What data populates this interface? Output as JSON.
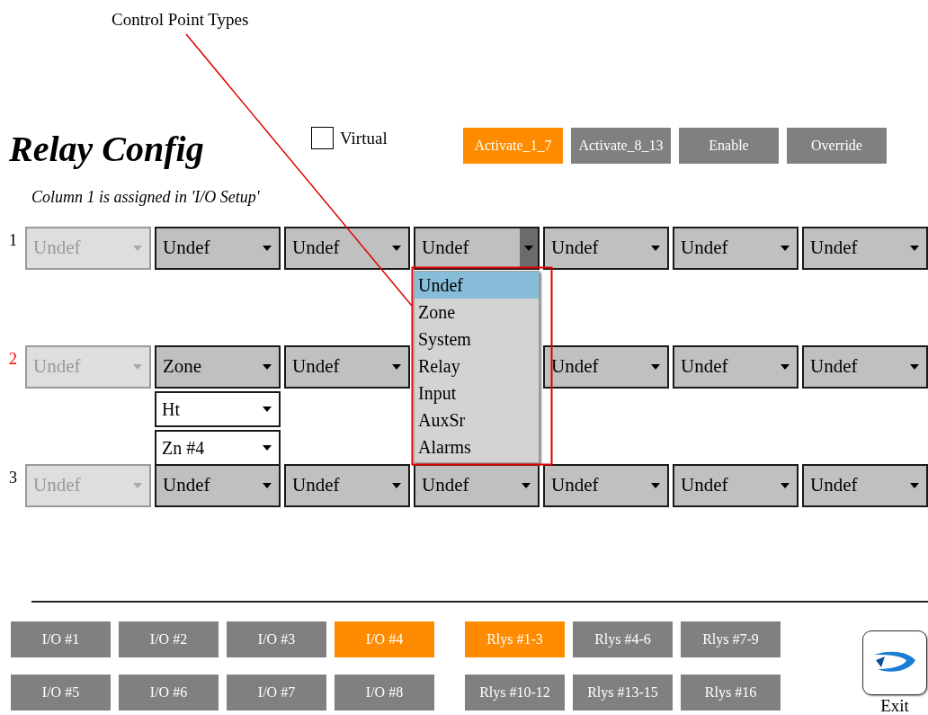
{
  "annotation": {
    "text": "Control Point Types"
  },
  "title": "Relay Config",
  "virtual": {
    "label": "Virtual",
    "checked": false
  },
  "mode_buttons": [
    {
      "label": "Activate_1_7",
      "selected": true
    },
    {
      "label": "Activate_8_13",
      "selected": false
    },
    {
      "label": "Enable",
      "selected": false
    },
    {
      "label": "Override",
      "selected": false
    }
  ],
  "note": "Column 1 is assigned in 'I/O Setup'",
  "rows": [
    {
      "number": "1",
      "selected": false,
      "cells": [
        {
          "value": "Undef",
          "disabled": true,
          "open": false
        },
        {
          "value": "Undef",
          "disabled": false,
          "open": false
        },
        {
          "value": "Undef",
          "disabled": false,
          "open": false
        },
        {
          "value": "Undef",
          "disabled": false,
          "open": true,
          "options": [
            {
              "label": "Undef",
              "selected": true
            },
            {
              "label": "Zone",
              "selected": false
            },
            {
              "label": "System",
              "selected": false
            },
            {
              "label": "Relay",
              "selected": false
            },
            {
              "label": "Input",
              "selected": false
            },
            {
              "label": "AuxSr",
              "selected": false
            },
            {
              "label": "Alarms",
              "selected": false
            }
          ]
        },
        {
          "value": "Undef",
          "disabled": false,
          "open": false
        },
        {
          "value": "Undef",
          "disabled": false,
          "open": false
        },
        {
          "value": "Undef",
          "disabled": false,
          "open": false
        }
      ]
    },
    {
      "number": "2",
      "selected": true,
      "cells": [
        {
          "value": "Undef",
          "disabled": true,
          "open": false
        },
        {
          "value": "Zone",
          "disabled": false,
          "open": false,
          "subs": [
            "Ht",
            "Zn #4"
          ]
        },
        {
          "value": "Undef",
          "disabled": false,
          "open": false
        },
        null,
        {
          "value": "Undef",
          "disabled": false,
          "open": false
        },
        {
          "value": "Undef",
          "disabled": false,
          "open": false
        },
        {
          "value": "Undef",
          "disabled": false,
          "open": false
        }
      ]
    },
    {
      "number": "3",
      "selected": false,
      "cells": [
        {
          "value": "Undef",
          "disabled": true,
          "open": false
        },
        {
          "value": "Undef",
          "disabled": false,
          "open": false
        },
        {
          "value": "Undef",
          "disabled": false,
          "open": false
        },
        {
          "value": "Undef",
          "disabled": false,
          "open": false
        },
        {
          "value": "Undef",
          "disabled": false,
          "open": false
        },
        {
          "value": "Undef",
          "disabled": false,
          "open": false
        },
        {
          "value": "Undef",
          "disabled": false,
          "open": false
        }
      ]
    }
  ],
  "io_buttons": [
    {
      "label": "I/O #1",
      "selected": false
    },
    {
      "label": "I/O #2",
      "selected": false
    },
    {
      "label": "I/O #3",
      "selected": false
    },
    {
      "label": "I/O #4",
      "selected": true
    },
    {
      "label": "I/O #5",
      "selected": false
    },
    {
      "label": "I/O #6",
      "selected": false
    },
    {
      "label": "I/O #7",
      "selected": false
    },
    {
      "label": "I/O #8",
      "selected": false
    }
  ],
  "relay_buttons": [
    {
      "label": "Rlys #1-3",
      "selected": true
    },
    {
      "label": "Rlys #4-6",
      "selected": false
    },
    {
      "label": "Rlys #7-9",
      "selected": false
    },
    {
      "label": "Rlys #10-12",
      "selected": false
    },
    {
      "label": "Rlys #13-15",
      "selected": false
    },
    {
      "label": "Rlys #16",
      "selected": false
    }
  ],
  "exit": {
    "label": "Exit"
  }
}
